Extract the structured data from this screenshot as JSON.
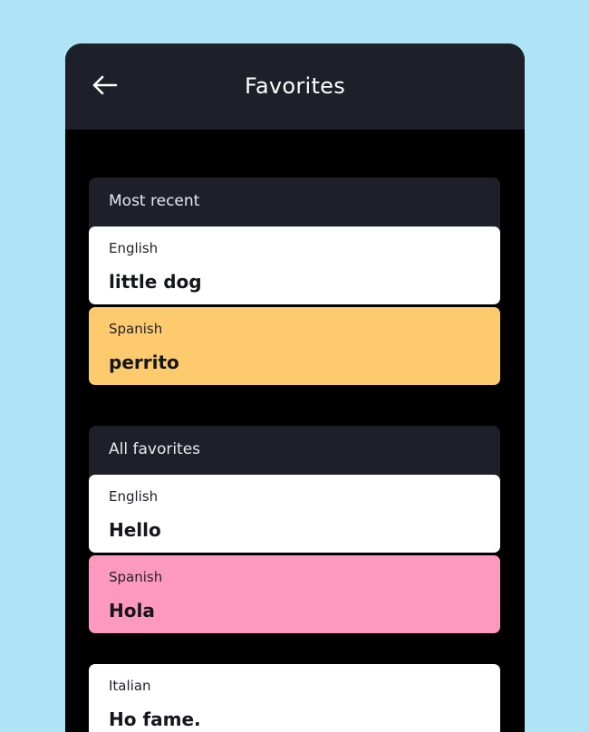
{
  "header": {
    "title": "Favorites",
    "back_icon": "arrow-left-icon"
  },
  "colors": {
    "background": "#aee4f5",
    "header": "#1e2029",
    "screen": "#000000",
    "spanish_recent": "#fdcb6e",
    "spanish_fav": "#fd98be",
    "card": "#ffffff"
  },
  "most_recent": {
    "label": "Most recent",
    "cards": [
      {
        "lang": "English",
        "word": "little dog"
      },
      {
        "lang": "Spanish",
        "word": "perrito"
      }
    ]
  },
  "all_favorites": {
    "label": "All favorites",
    "cards": [
      {
        "lang": "English",
        "word": "Hello"
      },
      {
        "lang": "Spanish",
        "word": "Hola"
      }
    ]
  },
  "extra": {
    "cards": [
      {
        "lang": "Italian",
        "word": "Ho fame."
      }
    ]
  }
}
